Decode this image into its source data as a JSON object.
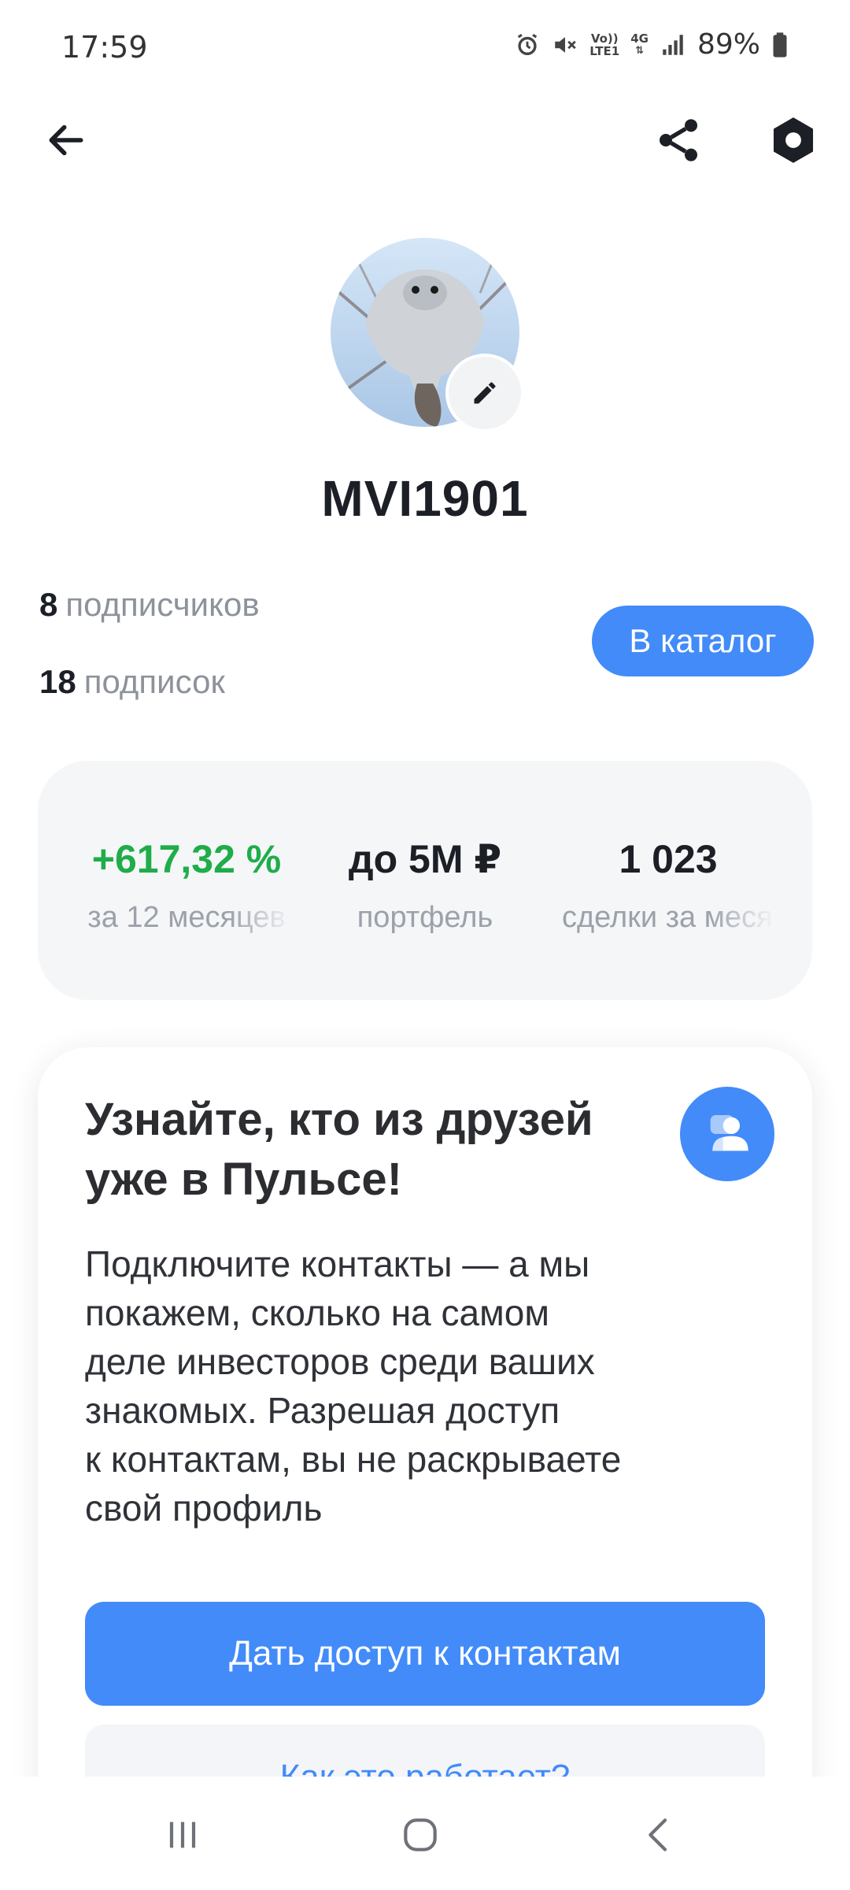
{
  "status_bar": {
    "time": "17:59",
    "volte_label_top": "Vo))",
    "volte_label_bottom": "LTE1",
    "network_label": "4G",
    "battery": "89%",
    "icons": [
      "alarm-icon",
      "mute-icon",
      "volte-icon",
      "network-4g-icon",
      "signal-icon",
      "battery-icon"
    ]
  },
  "app_bar": {
    "icons": [
      "back-arrow-icon",
      "share-icon",
      "settings-hexagon-icon"
    ]
  },
  "profile": {
    "username": "MVI1901",
    "followers_count": "8",
    "followers_label": "подписчиков",
    "following_count": "18",
    "following_label": "подписок",
    "catalog_button": "В каталог",
    "edit_icon": "pencil-icon"
  },
  "stats": [
    {
      "value": "+617,32 %",
      "label": "за 12 месяцев",
      "color": "#1fad4a"
    },
    {
      "value": "до 5M ₽",
      "label": "портфель"
    },
    {
      "value": "1 023",
      "label": "сделки за месяц"
    }
  ],
  "promo": {
    "title": "Узнайте, кто из друзей уже в Пульсе!",
    "text": "Подключите контакты — а мы\nпокажем, сколько на самом\nделе инвесторов среди ваших\nзнакомых. Разрешая доступ\nк контактам, вы не раскрываете\nсвой профиль",
    "icon": "contacts-icon",
    "primary_button": "Дать доступ к контактам",
    "secondary_button": "Как это работает?"
  },
  "colors": {
    "accent": "#428bf9",
    "positive": "#1fad4a",
    "card_bg": "#f5f6f8",
    "muted_text": "#8d929b"
  },
  "nav_bar": {
    "icons": [
      "recents-icon",
      "home-icon",
      "back-icon"
    ]
  }
}
